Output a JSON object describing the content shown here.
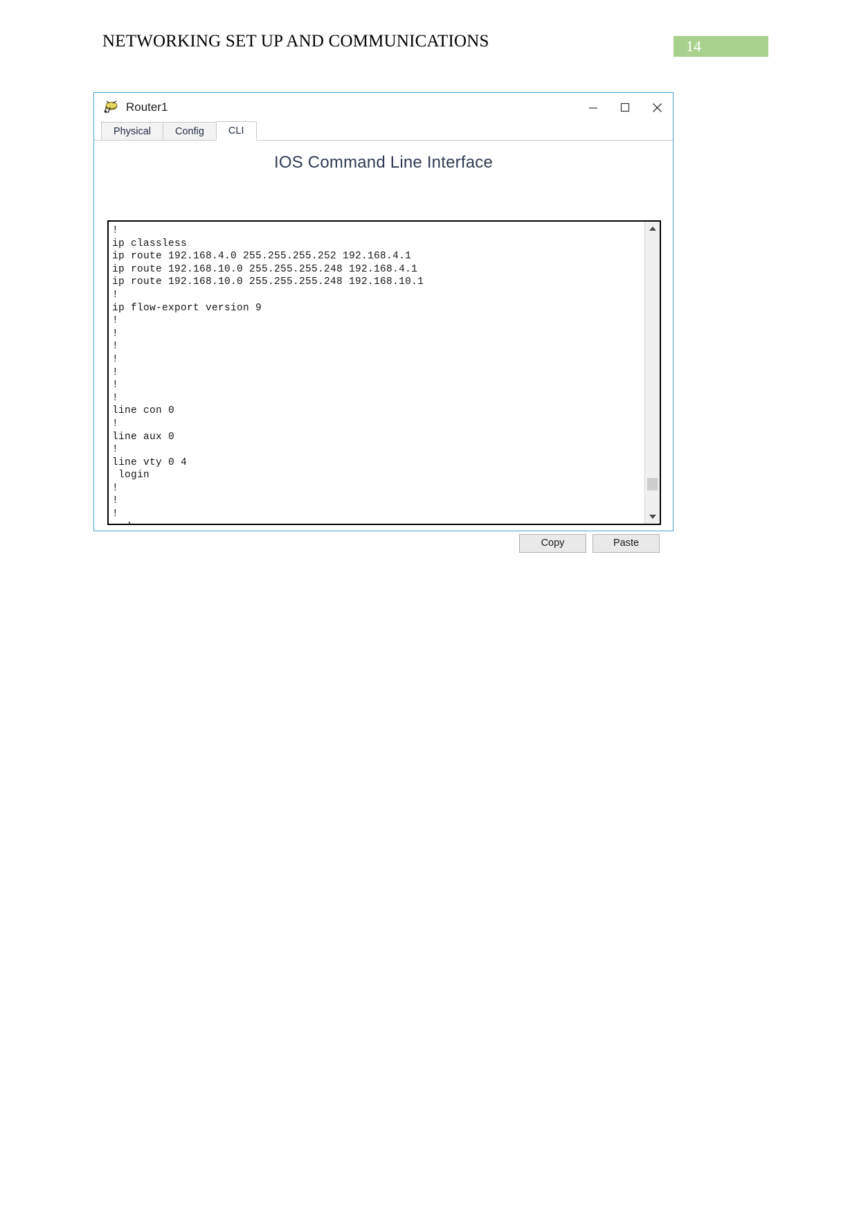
{
  "document": {
    "header_title": "NETWORKING SET UP AND COMMUNICATIONS",
    "page_number": "14",
    "badge_color": "#a9d18e"
  },
  "window": {
    "title": "Router1",
    "icon": "router-icon",
    "controls": {
      "minimize": "minimize-icon",
      "maximize": "maximize-icon",
      "close": "close-icon"
    }
  },
  "tabs": [
    {
      "label": "Physical",
      "active": false
    },
    {
      "label": "Config",
      "active": false
    },
    {
      "label": "CLI",
      "active": true
    }
  ],
  "panel": {
    "title": "IOS Command Line Interface"
  },
  "console": {
    "text": "!\nip classless\nip route 192.168.4.0 255.255.255.252 192.168.4.1\nip route 192.168.10.0 255.255.255.248 192.168.4.1\nip route 192.168.10.0 255.255.255.248 192.168.10.1\n!\nip flow-export version 9\n!\n!\n!\n!\n!\n!\n!\nline con 0\n!\nline aux 0\n!\nline vty 0 4\n login\n!\n!\n!\nend",
    "scrollbar": {
      "up_arrow": "chevron-up-icon",
      "down_arrow": "chevron-down-icon"
    }
  },
  "buttons": {
    "copy": "Copy",
    "paste": "Paste"
  }
}
